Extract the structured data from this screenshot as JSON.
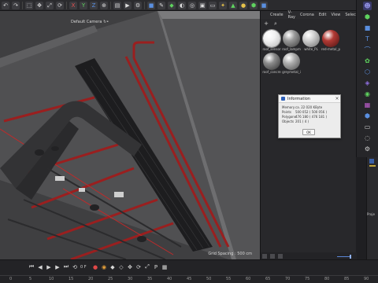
{
  "toolbar": {
    "icons": [
      "undo-icon",
      "redo-icon",
      "select-icon",
      "move-icon",
      "scale-icon",
      "rotate-icon",
      "x-axis-icon",
      "y-axis-icon",
      "z-axis-icon",
      "coordinate-icon",
      "render-view-icon",
      "render-icon",
      "render-settings-icon",
      "cube-icon",
      "spline-pen-icon",
      "generator-icon",
      "deformer-icon",
      "field-icon",
      "scene-icon",
      "camera-icon",
      "light-icon",
      "tag-icon",
      "python-icon",
      "plugin-icon"
    ],
    "axis_x": "X",
    "axis_y": "Y",
    "axis_z": "Z"
  },
  "viewport": {
    "camera_label": "Default Camera ↻•",
    "grid_label": "Grid Spacing : 500 cm"
  },
  "material_panel": {
    "menu": [
      "Create",
      "V-Ray",
      "Corona",
      "Edit",
      "View",
      "Select"
    ],
    "materials": [
      {
        "name": "roof_sensor",
        "color": "#f2f2f2",
        "shade": "#b8b8b8",
        "selected": true
      },
      {
        "name": "roof_lampm",
        "color": "#9a9a9a",
        "shade": "#3a3a3a",
        "selected": false
      },
      {
        "name": "white_PL",
        "color": "#d0d0d0",
        "shade": "#6b6b6b",
        "selected": false
      },
      {
        "name": "red-metal_pi",
        "color": "#b23a34",
        "shade": "#4a1212",
        "selected": false
      },
      {
        "name": "roof_concre",
        "color": "#8c8c8c",
        "shade": "#2f2f2f",
        "selected": false
      },
      {
        "name": "greymetal_i",
        "color": "#aeaeae",
        "shade": "#4b4b4b",
        "selected": false
      }
    ]
  },
  "dialog": {
    "title": "Information",
    "close_glyph": "×",
    "rows": [
      {
        "key": "Memory",
        "value": "ca. 22 020 KByte"
      },
      {
        "key": "Points",
        "value": "500 052 ( 500 056 )"
      },
      {
        "key": "Polygons",
        "value": "476 180 ( 476 181 )"
      },
      {
        "key": "Objects",
        "value": "201 ( 4 )"
      }
    ],
    "ok_label": "OK"
  },
  "attribute_panel": {
    "label": "Proje"
  },
  "timeline": {
    "current_frame": "0 F",
    "ruler": [
      "0",
      "5",
      "10",
      "15",
      "20",
      "25",
      "30",
      "35",
      "40",
      "45",
      "50",
      "55",
      "60",
      "65",
      "70",
      "75",
      "80",
      "85",
      "90"
    ]
  },
  "colors": {
    "accent_blue": "#3a60a8",
    "pipe_red": "#9a1f1f"
  }
}
